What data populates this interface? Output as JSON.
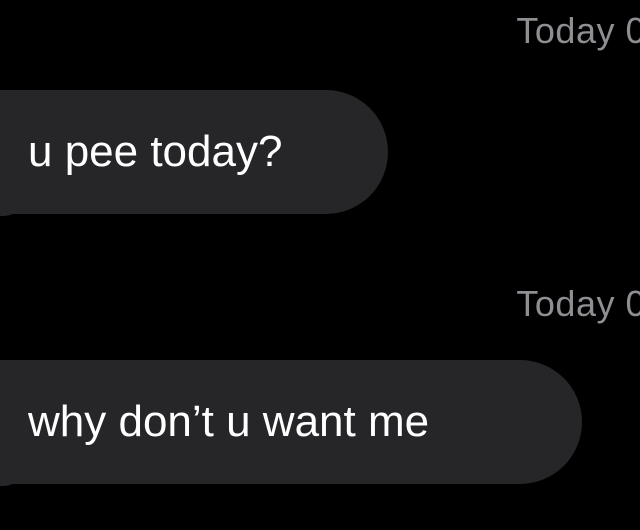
{
  "conversation": {
    "messages": [
      {
        "timestamp": "Today 0",
        "text": "u pee today?"
      },
      {
        "timestamp": "Today 0",
        "text": "why don’t u want me"
      }
    ]
  },
  "colors": {
    "background": "#000000",
    "bubble": "#262629",
    "timestamp": "#8e8e93",
    "text": "#ffffff"
  }
}
